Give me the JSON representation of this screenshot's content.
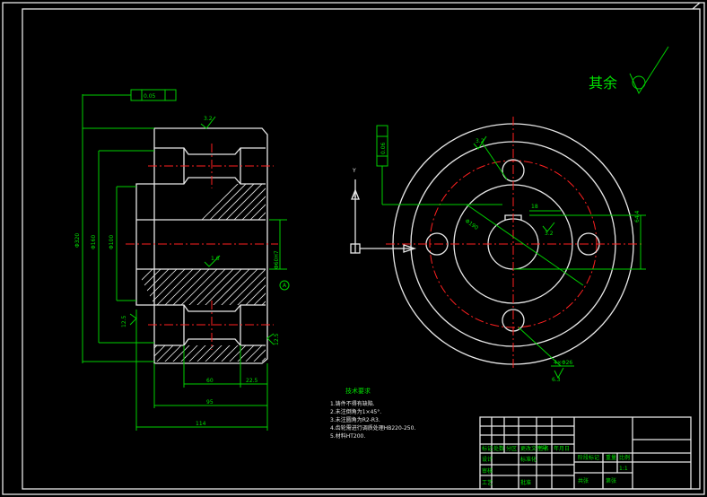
{
  "drawing": {
    "roughness_note": "其余",
    "dimensions": {
      "flatness": "0.05",
      "phi_outer": "Φ320",
      "phi_mid": "Φ160",
      "phi_hub": "Φ100",
      "bore": "Φ60H7",
      "width_total": "114",
      "width_mid": "95",
      "width_60": "60",
      "width_22": "22.5",
      "pcd": "Φ190",
      "holes": "4×Φ26",
      "keyway": "18",
      "key_depth": "64.4",
      "perp_tol": "0.06"
    },
    "roughness": {
      "top": "3.2",
      "bore": "1.6",
      "left": "12.5",
      "right": "12.5",
      "key": "3.2",
      "hole": "6.3",
      "hole2": "3.2"
    },
    "datum": "A",
    "view_labels": {
      "arrow_y": "Y",
      "arrow_a": "A"
    },
    "tech_req": {
      "title": "技术要求",
      "lines": [
        "1.铸件不得有缺陷.",
        "2.未注倒角为1×45°.",
        "3.未注圆角为R2-R3.",
        "4.齿轮需进行调质处理HB220-250.",
        "5.材料HT200."
      ]
    },
    "title_block": {
      "cells": [
        "标记",
        "处数",
        "分区",
        "更改文件号",
        "签名",
        "年月日",
        "设计",
        "标准化",
        "审核",
        "工艺",
        "批准",
        "阶段标记",
        "重量",
        "比例",
        "共张",
        "第张",
        "1:1"
      ]
    }
  }
}
